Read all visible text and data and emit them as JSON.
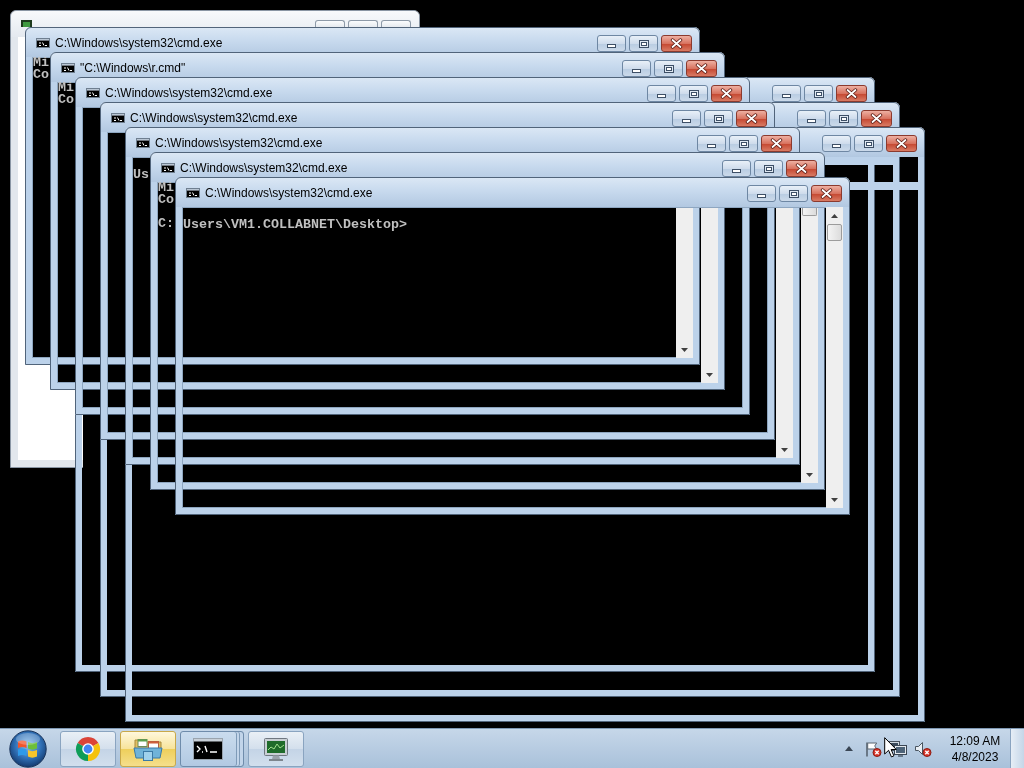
{
  "desktop": {
    "windows": [
      {
        "kind": "dialog"
      },
      {
        "kind": "console",
        "title": "C:\\Windows\\system32\\cmd.exe",
        "lines": [
          "Mi",
          "Co"
        ],
        "scrollbar": true
      },
      {
        "kind": "console",
        "title": "\"C:\\Windows\\r.cmd\"",
        "lines": [
          "Mi",
          "Co"
        ],
        "scrollbar": true
      },
      {
        "kind": "outline"
      },
      {
        "kind": "console",
        "title": "C:\\Windows\\system32\\cmd.exe",
        "scrollbar": false
      },
      {
        "kind": "outline"
      },
      {
        "kind": "console",
        "title": "C:\\Windows\\system32\\cmd.exe",
        "scrollbar": false
      },
      {
        "kind": "outline"
      },
      {
        "kind": "console",
        "title": "C:\\Windows\\system32\\cmd.exe",
        "prompt": "Us",
        "scrollbar": true
      },
      {
        "kind": "console",
        "title": "C:\\Windows\\system32\\cmd.exe",
        "lines": [
          "Mi",
          "Co"
        ],
        "prompt": "C:",
        "scrollbar": true
      },
      {
        "kind": "console",
        "title": "C:\\Windows\\system32\\cmd.exe",
        "prompt": "Users\\VM1.COLLABNET\\Desktop>",
        "scrollbar": true
      }
    ]
  },
  "taskbar": {
    "items": [
      {
        "kind": "browser",
        "highlighted": false,
        "active": false
      },
      {
        "kind": "folder",
        "highlighted": true,
        "active": false
      },
      {
        "kind": "terminal",
        "highlighted": false,
        "active": true
      },
      {
        "kind": "monitor",
        "highlighted": false,
        "active": false
      }
    ],
    "tray": [
      {
        "kind": "flag",
        "error": true
      },
      {
        "kind": "network",
        "error": false
      },
      {
        "kind": "speaker",
        "error": true
      }
    ],
    "clock": {
      "time": "12:09 AM",
      "date": "4/8/2023"
    }
  }
}
